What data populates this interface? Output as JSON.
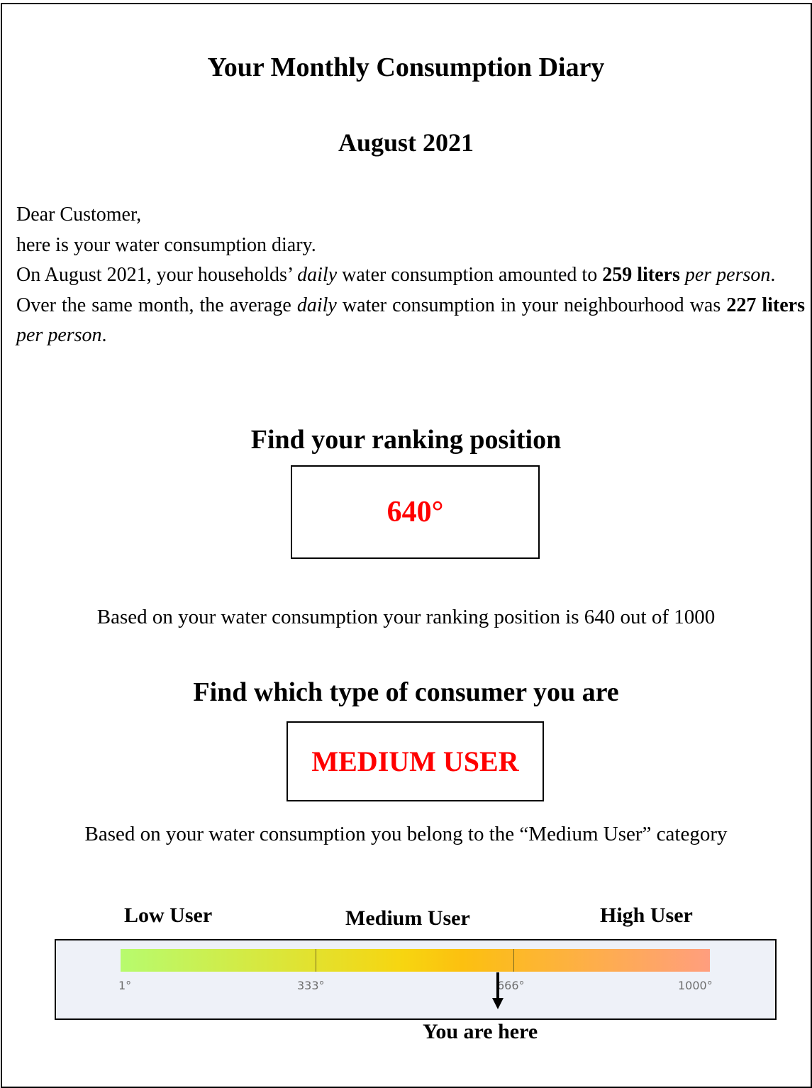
{
  "header": {
    "title": "Your Monthly Consumption Diary",
    "period": "August 2021"
  },
  "letter": {
    "greeting": "Dear Customer,",
    "intro": "here is your water consumption diary.",
    "household": {
      "prefix": "On August 2021, your households’ ",
      "daily": "daily",
      "middle": " water consumption amounted to ",
      "amount": "259 liters",
      "space": " ",
      "per": "per person",
      "suffix": "."
    },
    "neighbourhood": {
      "prefix": "Over the same month, the average ",
      "daily": "daily",
      "middle": " water consumption in your neighbourhood was ",
      "amount": "227 liters",
      "space": " ",
      "per": "per person",
      "suffix": "."
    }
  },
  "ranking": {
    "heading": "Find your ranking position",
    "value": "640°",
    "note": "Based on your water consumption your ranking position is 640 out of 1000"
  },
  "category": {
    "heading": "Find which type of consumer you are",
    "value": "MEDIUM USER",
    "note": "Based on your water consumption you belong to the “Medium User” category"
  },
  "scale": {
    "labels": {
      "low": "Low User",
      "medium": "Medium User",
      "high": "High User"
    },
    "ticks": [
      "1°",
      "333°",
      "666°",
      "1000°"
    ],
    "position": 640,
    "max": 1000,
    "marker_label": "You are here",
    "colors": {
      "low": "#b7fb6e",
      "mid": "#f7d510",
      "high": "#ff9e7e"
    }
  }
}
